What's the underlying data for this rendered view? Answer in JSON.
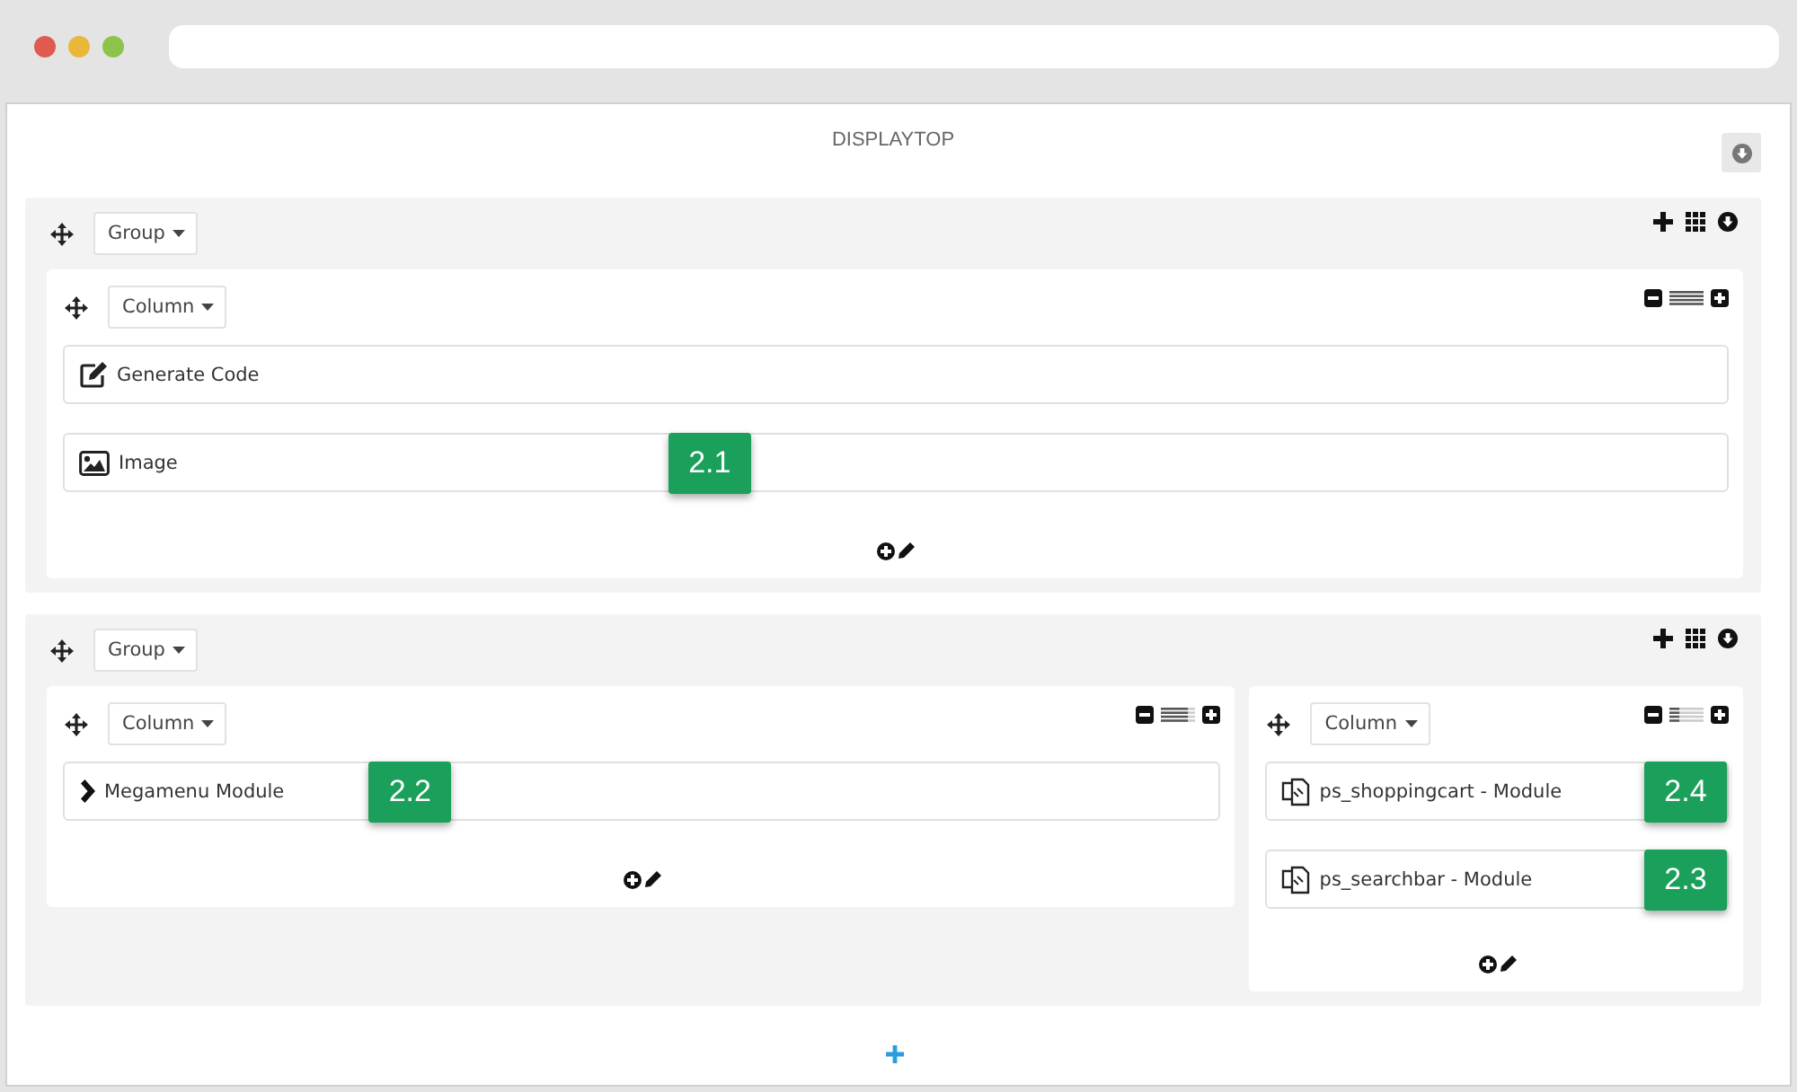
{
  "header": {
    "title": "DISPLAYTOP"
  },
  "groups": [
    {
      "label": "Group",
      "columns": [
        {
          "label": "Column",
          "kind": "full",
          "items": [
            {
              "kind": "code",
              "label": "Generate Code"
            },
            {
              "kind": "image",
              "label": "Image",
              "badge": "2.1"
            }
          ]
        }
      ]
    },
    {
      "label": "Group",
      "columns": [
        {
          "label": "Column",
          "kind": "wide",
          "items": [
            {
              "kind": "menu",
              "label": "Megamenu Module",
              "badge": "2.2"
            }
          ]
        },
        {
          "label": "Column",
          "kind": "narrow",
          "items": [
            {
              "kind": "module",
              "label": "ps_shoppingcart - Module",
              "badge": "2.4"
            },
            {
              "kind": "module",
              "label": "ps_searchbar - Module",
              "badge": "2.3"
            }
          ]
        }
      ]
    }
  ]
}
